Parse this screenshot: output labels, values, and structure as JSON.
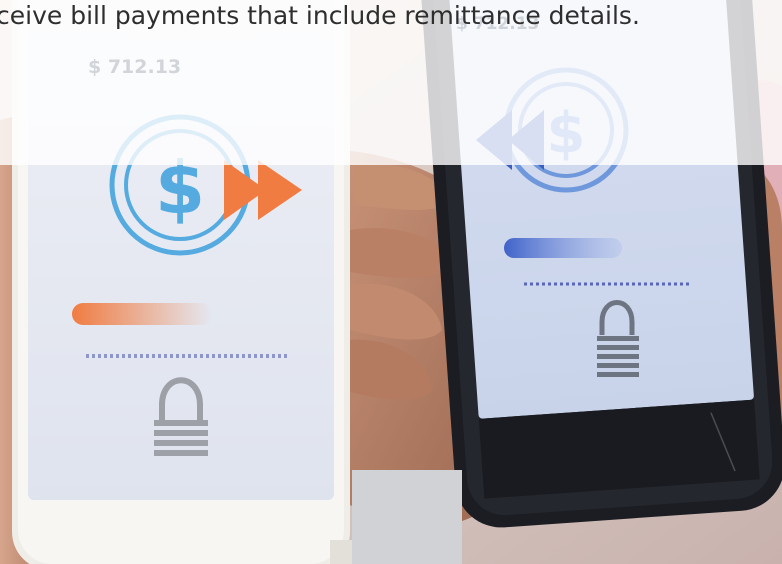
{
  "caption": {
    "text": "ceive bill payments that include remittance details."
  },
  "phones": {
    "left": {
      "amount": "$ 712.13"
    },
    "right": {
      "amount": "$ 712.13"
    }
  },
  "colors": {
    "overlay": "#ffffff",
    "accent_orange": "#f07c42",
    "accent_blue": "#3f74d8",
    "dollar_ring_blue": "#4aa3dd",
    "screen_bg": "#dde3ef",
    "phone_white": "#f4f2ee",
    "phone_black": "#1b1d23"
  },
  "icons": [
    "dollar-sign-icon",
    "arrow-play-icon",
    "padlock-icon"
  ]
}
